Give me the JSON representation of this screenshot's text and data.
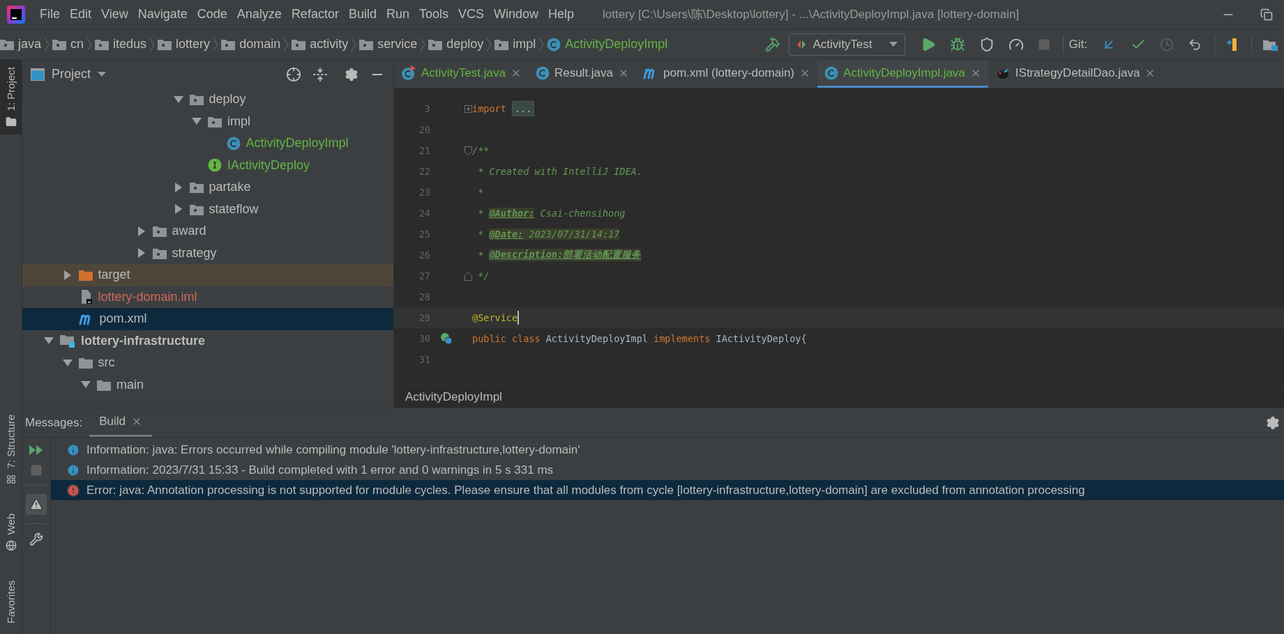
{
  "menu_bar": {
    "items": [
      "File",
      "Edit",
      "View",
      "Navigate",
      "Code",
      "Analyze",
      "Refactor",
      "Build",
      "Run",
      "Tools",
      "VCS",
      "Window",
      "Help"
    ]
  },
  "window": {
    "title": "lottery [C:\\Users\\陈\\Desktop\\lottery] - ...\\ActivityDeployImpl.java [lottery-domain]"
  },
  "nav_bar": {
    "crumbs": [
      {
        "label": "java",
        "kind": "folder"
      },
      {
        "label": "cn",
        "kind": "folder"
      },
      {
        "label": "itedus",
        "kind": "folder"
      },
      {
        "label": "lottery",
        "kind": "folder"
      },
      {
        "label": "domain",
        "kind": "folder"
      },
      {
        "label": "activity",
        "kind": "folder"
      },
      {
        "label": "service",
        "kind": "folder"
      },
      {
        "label": "deploy",
        "kind": "folder"
      },
      {
        "label": "impl",
        "kind": "folder"
      },
      {
        "label": "ActivityDeployImpl",
        "kind": "class"
      }
    ]
  },
  "toolbar": {
    "run_configuration": "ActivityTest",
    "git_label": "Git:"
  },
  "left_stripe": {
    "top": [
      {
        "label": "1: Project",
        "selected": true
      }
    ],
    "bottom": [
      {
        "label": "7: Structure",
        "selected": false
      },
      {
        "label": "Web",
        "selected": false
      },
      {
        "label": "Favorites",
        "selected": false
      }
    ]
  },
  "project_panel": {
    "title": "Project",
    "tree": [
      {
        "children": [
          {
            "children": [
              {
                "children": [
                  {
                    "children": [
                      {
                        "children": [
                          {
                            "children": [
                              {
                                "children": [
                                  {
                                    "label": "deploy",
                                    "kind": "folder",
                                    "expanded": true,
                                    "selected": false,
                                    "children": [
                                      {
                                        "label": "impl",
                                        "kind": "folder",
                                        "expanded": true,
                                        "selected": false,
                                        "children": [
                                          {
                                            "label": "ActivityDeployImpl",
                                            "kind": "class",
                                            "color": "#62b543",
                                            "selected": false
                                          }
                                        ]
                                      },
                                      {
                                        "label": "IActivityDeploy",
                                        "kind": "interface",
                                        "color": "#62b543",
                                        "selected": false
                                      }
                                    ]
                                  },
                                  {
                                    "label": "partake",
                                    "kind": "folder",
                                    "expanded": false,
                                    "selected": false
                                  },
                                  {
                                    "label": "stateflow",
                                    "kind": "folder",
                                    "expanded": false,
                                    "selected": false
                                  }
                                ]
                              }
                            ]
                          },
                          {
                            "label": "award",
                            "kind": "folder",
                            "expanded": false,
                            "selected": false
                          },
                          {
                            "label": "strategy",
                            "kind": "folder",
                            "expanded": false,
                            "selected": false
                          }
                        ]
                      }
                    ]
                  }
                ]
              }
            ]
          },
          {
            "label": "target",
            "kind": "excluded-folder",
            "expanded": false,
            "selected": false
          },
          {
            "label": "lottery-domain.iml",
            "kind": "iml",
            "color": "#d1675a",
            "selected": false
          },
          {
            "label": "pom.xml",
            "kind": "maven",
            "selected": true
          }
        ]
      },
      {
        "label": "lottery-infrastructure",
        "kind": "module",
        "expanded": true,
        "selected": false,
        "children": [
          {
            "label": "src",
            "kind": "plain-folder",
            "expanded": true,
            "selected": false,
            "children": [
              {
                "label": "main",
                "kind": "plain-folder",
                "expanded": true,
                "selected": false
              }
            ]
          }
        ]
      }
    ]
  },
  "editor": {
    "tabs": [
      {
        "label": "ActivityTest.java",
        "kind": "test-class",
        "color": "#62b543",
        "selected": false
      },
      {
        "label": "Result.java",
        "kind": "class",
        "selected": false
      },
      {
        "label": "pom.xml (lottery-domain)",
        "kind": "maven",
        "selected": false
      },
      {
        "label": "ActivityDeployImpl.java",
        "kind": "class",
        "color": "#62b543",
        "selected": true
      },
      {
        "label": "IStrategyDetailDao.java",
        "kind": "mapper",
        "selected": false
      }
    ],
    "lines": [
      {
        "number": "3",
        "kind": "fold-collapsed",
        "segments": [
          {
            "kind": "keyword",
            "text": "import "
          },
          {
            "kind": "folded",
            "text": "..."
          }
        ]
      },
      {
        "number": "20",
        "kind": "plain"
      },
      {
        "number": "21",
        "kind": "fold-start",
        "segments": [
          {
            "kind": "doc",
            "text": "/**"
          }
        ]
      },
      {
        "number": "22",
        "kind": "plain",
        "segments": [
          {
            "kind": "doc",
            "text": " * Created with IntelliJ IDEA."
          }
        ]
      },
      {
        "number": "23",
        "kind": "plain",
        "segments": [
          {
            "kind": "doc",
            "text": " *"
          }
        ]
      },
      {
        "number": "24",
        "kind": "plain",
        "segments": [
          {
            "kind": "doc",
            "text": " * "
          },
          {
            "kind": "doctag",
            "text": "@Author:"
          },
          {
            "kind": "doc",
            "text": " Csai-chensihong"
          }
        ]
      },
      {
        "number": "25",
        "kind": "plain",
        "segments": [
          {
            "kind": "doc",
            "text": " * "
          },
          {
            "kind": "doctag",
            "text": "@Date:"
          },
          {
            "kind": "docvalue",
            "text": " 2023/07/31/14:17"
          }
        ]
      },
      {
        "number": "26",
        "kind": "plain",
        "segments": [
          {
            "kind": "doc",
            "text": " * "
          },
          {
            "kind": "doctag",
            "text": "@Description:部署活动配置服务"
          }
        ]
      },
      {
        "number": "27",
        "kind": "fold-end",
        "segments": [
          {
            "kind": "doc",
            "text": " */"
          }
        ]
      },
      {
        "number": "28",
        "kind": "plain"
      },
      {
        "number": "29",
        "kind": "plain",
        "current": true,
        "segments": [
          {
            "kind": "annotation",
            "text": "@Service"
          }
        ]
      },
      {
        "number": "30",
        "kind": "implements",
        "segments": [
          {
            "kind": "keyword",
            "text": "public class "
          },
          {
            "kind": "plain",
            "text": "ActivityDeployImpl "
          },
          {
            "kind": "keyword",
            "text": "implements "
          },
          {
            "kind": "plain",
            "text": "IActivityDeploy{"
          }
        ]
      },
      {
        "number": "31",
        "kind": "plain"
      }
    ],
    "breadcrumb": "ActivityDeployImpl"
  },
  "messages_panel": {
    "label": "Messages:",
    "tabs": [
      {
        "label": "Build",
        "selected": true
      }
    ],
    "rows": [
      {
        "kind": "info",
        "selected": false,
        "text": "Information: java: Errors occurred while compiling module 'lottery-infrastructure,lottery-domain'"
      },
      {
        "kind": "info",
        "selected": false,
        "text": "Information: 2023/7/31 15:33 - Build completed with 1 error and 0 warnings in 5 s 331 ms"
      },
      {
        "kind": "error",
        "selected": true,
        "text": "Error: java: Annotation processing is not supported for module cycles. Please ensure that all modules from cycle [lottery-infrastructure,lottery-domain] are excluded from annotation processing"
      }
    ]
  }
}
